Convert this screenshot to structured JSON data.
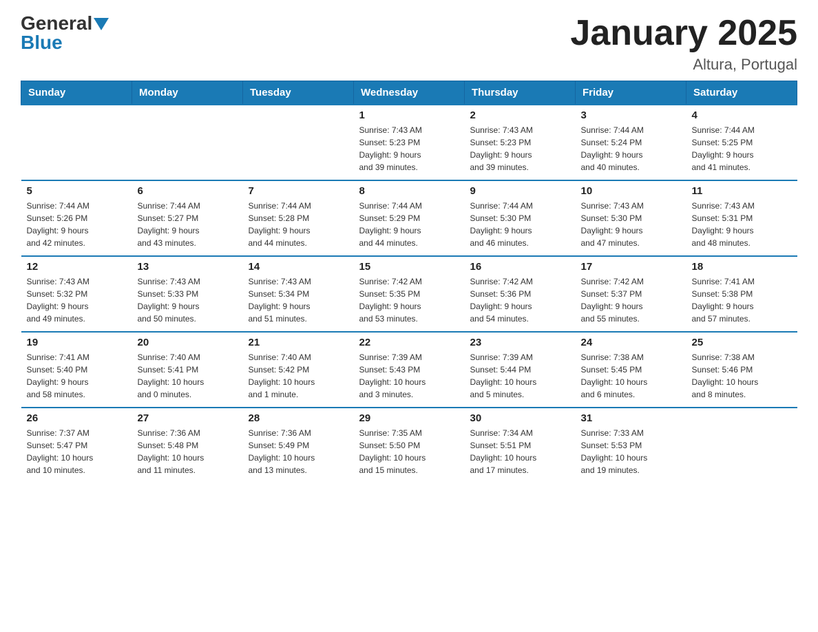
{
  "header": {
    "logo_general": "General",
    "logo_blue": "Blue",
    "title": "January 2025",
    "subtitle": "Altura, Portugal"
  },
  "days_of_week": [
    "Sunday",
    "Monday",
    "Tuesday",
    "Wednesday",
    "Thursday",
    "Friday",
    "Saturday"
  ],
  "weeks": [
    [
      {
        "day": "",
        "info": ""
      },
      {
        "day": "",
        "info": ""
      },
      {
        "day": "",
        "info": ""
      },
      {
        "day": "1",
        "info": "Sunrise: 7:43 AM\nSunset: 5:23 PM\nDaylight: 9 hours\nand 39 minutes."
      },
      {
        "day": "2",
        "info": "Sunrise: 7:43 AM\nSunset: 5:23 PM\nDaylight: 9 hours\nand 39 minutes."
      },
      {
        "day": "3",
        "info": "Sunrise: 7:44 AM\nSunset: 5:24 PM\nDaylight: 9 hours\nand 40 minutes."
      },
      {
        "day": "4",
        "info": "Sunrise: 7:44 AM\nSunset: 5:25 PM\nDaylight: 9 hours\nand 41 minutes."
      }
    ],
    [
      {
        "day": "5",
        "info": "Sunrise: 7:44 AM\nSunset: 5:26 PM\nDaylight: 9 hours\nand 42 minutes."
      },
      {
        "day": "6",
        "info": "Sunrise: 7:44 AM\nSunset: 5:27 PM\nDaylight: 9 hours\nand 43 minutes."
      },
      {
        "day": "7",
        "info": "Sunrise: 7:44 AM\nSunset: 5:28 PM\nDaylight: 9 hours\nand 44 minutes."
      },
      {
        "day": "8",
        "info": "Sunrise: 7:44 AM\nSunset: 5:29 PM\nDaylight: 9 hours\nand 44 minutes."
      },
      {
        "day": "9",
        "info": "Sunrise: 7:44 AM\nSunset: 5:30 PM\nDaylight: 9 hours\nand 46 minutes."
      },
      {
        "day": "10",
        "info": "Sunrise: 7:43 AM\nSunset: 5:30 PM\nDaylight: 9 hours\nand 47 minutes."
      },
      {
        "day": "11",
        "info": "Sunrise: 7:43 AM\nSunset: 5:31 PM\nDaylight: 9 hours\nand 48 minutes."
      }
    ],
    [
      {
        "day": "12",
        "info": "Sunrise: 7:43 AM\nSunset: 5:32 PM\nDaylight: 9 hours\nand 49 minutes."
      },
      {
        "day": "13",
        "info": "Sunrise: 7:43 AM\nSunset: 5:33 PM\nDaylight: 9 hours\nand 50 minutes."
      },
      {
        "day": "14",
        "info": "Sunrise: 7:43 AM\nSunset: 5:34 PM\nDaylight: 9 hours\nand 51 minutes."
      },
      {
        "day": "15",
        "info": "Sunrise: 7:42 AM\nSunset: 5:35 PM\nDaylight: 9 hours\nand 53 minutes."
      },
      {
        "day": "16",
        "info": "Sunrise: 7:42 AM\nSunset: 5:36 PM\nDaylight: 9 hours\nand 54 minutes."
      },
      {
        "day": "17",
        "info": "Sunrise: 7:42 AM\nSunset: 5:37 PM\nDaylight: 9 hours\nand 55 minutes."
      },
      {
        "day": "18",
        "info": "Sunrise: 7:41 AM\nSunset: 5:38 PM\nDaylight: 9 hours\nand 57 minutes."
      }
    ],
    [
      {
        "day": "19",
        "info": "Sunrise: 7:41 AM\nSunset: 5:40 PM\nDaylight: 9 hours\nand 58 minutes."
      },
      {
        "day": "20",
        "info": "Sunrise: 7:40 AM\nSunset: 5:41 PM\nDaylight: 10 hours\nand 0 minutes."
      },
      {
        "day": "21",
        "info": "Sunrise: 7:40 AM\nSunset: 5:42 PM\nDaylight: 10 hours\nand 1 minute."
      },
      {
        "day": "22",
        "info": "Sunrise: 7:39 AM\nSunset: 5:43 PM\nDaylight: 10 hours\nand 3 minutes."
      },
      {
        "day": "23",
        "info": "Sunrise: 7:39 AM\nSunset: 5:44 PM\nDaylight: 10 hours\nand 5 minutes."
      },
      {
        "day": "24",
        "info": "Sunrise: 7:38 AM\nSunset: 5:45 PM\nDaylight: 10 hours\nand 6 minutes."
      },
      {
        "day": "25",
        "info": "Sunrise: 7:38 AM\nSunset: 5:46 PM\nDaylight: 10 hours\nand 8 minutes."
      }
    ],
    [
      {
        "day": "26",
        "info": "Sunrise: 7:37 AM\nSunset: 5:47 PM\nDaylight: 10 hours\nand 10 minutes."
      },
      {
        "day": "27",
        "info": "Sunrise: 7:36 AM\nSunset: 5:48 PM\nDaylight: 10 hours\nand 11 minutes."
      },
      {
        "day": "28",
        "info": "Sunrise: 7:36 AM\nSunset: 5:49 PM\nDaylight: 10 hours\nand 13 minutes."
      },
      {
        "day": "29",
        "info": "Sunrise: 7:35 AM\nSunset: 5:50 PM\nDaylight: 10 hours\nand 15 minutes."
      },
      {
        "day": "30",
        "info": "Sunrise: 7:34 AM\nSunset: 5:51 PM\nDaylight: 10 hours\nand 17 minutes."
      },
      {
        "day": "31",
        "info": "Sunrise: 7:33 AM\nSunset: 5:53 PM\nDaylight: 10 hours\nand 19 minutes."
      },
      {
        "day": "",
        "info": ""
      }
    ]
  ]
}
